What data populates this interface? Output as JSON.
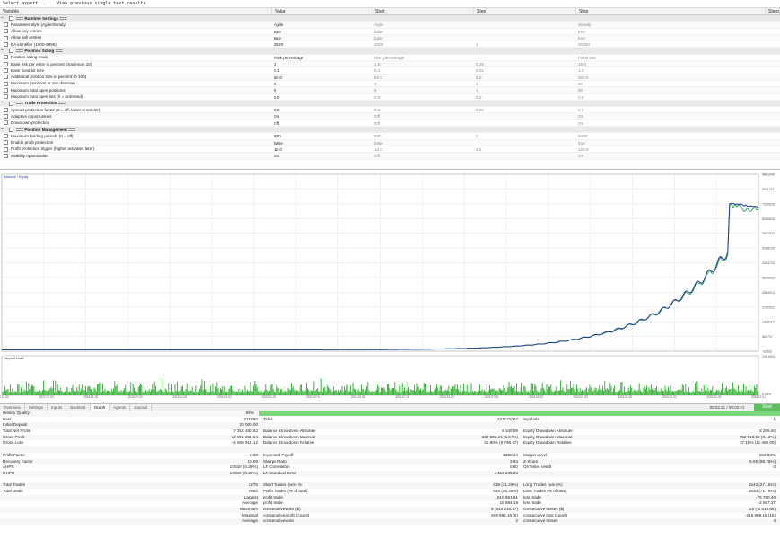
{
  "topbar": {
    "item1": "Select expert...",
    "item2": "View previous single test results"
  },
  "params": {
    "headers": [
      "Variable",
      "Value",
      "Start",
      "Step",
      "Stop",
      "Steps"
    ],
    "rows": [
      {
        "type": "group",
        "name": "=== Runtime Settings ===",
        "value": "",
        "start": "",
        "step": "",
        "stop": ""
      },
      {
        "type": "row",
        "name": "Parameter style (Agile/Steady)",
        "value": "Agile",
        "start": "Agile",
        "step": "",
        "stop": "Steady"
      },
      {
        "type": "row",
        "name": "Allow buy entries",
        "value": "true",
        "start": "false",
        "step": "",
        "stop": "true"
      },
      {
        "type": "row",
        "name": "Allow sell entries",
        "value": "true",
        "start": "false",
        "step": "",
        "stop": "true"
      },
      {
        "type": "row",
        "name": "EA identifier (1000-9999)",
        "value": "2020",
        "start": "2020",
        "step": "1",
        "stop": "20200"
      },
      {
        "type": "group",
        "name": "=== Position Sizing ===",
        "value": "",
        "start": "",
        "step": "",
        "stop": ""
      },
      {
        "type": "row",
        "name": "Position sizing mode",
        "value": "Risk percentage",
        "start": "Risk percentage",
        "step": "",
        "stop": "Fixed lots"
      },
      {
        "type": "row",
        "name": "Base risk per entry in percent (maximum 10)",
        "value": "1",
        "start": "1.5",
        "step": "0.15",
        "stop": "15.0"
      },
      {
        "type": "row",
        "name": "Base fixed lot size",
        "value": "0.1",
        "start": "0.1",
        "step": "0.01",
        "stop": "1.0"
      },
      {
        "type": "row",
        "name": "Additional position size in percent (0-100)",
        "value": "50.0",
        "start": "50.0",
        "step": "5.0",
        "stop": "500.0"
      },
      {
        "type": "row",
        "name": "Maximum positions in one direction",
        "value": "5",
        "start": "5",
        "step": "1",
        "stop": "50"
      },
      {
        "type": "row",
        "name": "Maximum total open positions",
        "value": "5",
        "start": "5",
        "step": "1",
        "stop": "50"
      },
      {
        "type": "row",
        "name": "Maximum total open lots (0 = unlimited)",
        "value": "0.0",
        "start": "0.0",
        "step": "0.0",
        "stop": "0.0"
      },
      {
        "type": "group",
        "name": "=== Trade Protection ===",
        "value": "",
        "start": "",
        "step": "",
        "stop": ""
      },
      {
        "type": "row",
        "name": "Spread protection factor (0 = off, lower is stricter)",
        "value": "0.5",
        "start": "0.5",
        "step": "0.05",
        "stop": "5.0"
      },
      {
        "type": "row",
        "name": "Adaptive opportunities",
        "value": "On",
        "start": "Off",
        "step": "",
        "stop": "On"
      },
      {
        "type": "row",
        "name": "Drawdown protection",
        "value": "Off",
        "start": "Off",
        "step": "",
        "stop": "On"
      },
      {
        "type": "group",
        "name": "=== Position Management ===",
        "value": "",
        "start": "",
        "step": "",
        "stop": ""
      },
      {
        "type": "row",
        "name": "Maximum holding periods (0 = off)",
        "value": "500",
        "start": "500",
        "step": "1",
        "stop": "5000"
      },
      {
        "type": "row",
        "name": "Enable profit protection",
        "value": "false",
        "start": "false",
        "step": "",
        "stop": "true"
      },
      {
        "type": "row",
        "name": "Profit protection trigger (higher activates later)",
        "value": "12.0",
        "start": "12.0",
        "step": "1.2",
        "stop": "120.0"
      },
      {
        "type": "row",
        "name": "Stability optimization",
        "value": "On",
        "start": "Off",
        "step": "",
        "stop": "On"
      }
    ]
  },
  "chart": {
    "legend": "Balance / Equity",
    "deposit_label": "Deposit Load",
    "colors": {
      "balance": "#1f3f8f",
      "equity": "#2a9a5a",
      "load": "#22aa22",
      "grid": "#e6e6e6"
    },
    "y_ticks": [
      "8881646",
      "8011221",
      "7290926",
      "6556925",
      "5822543",
      "5088125",
      "4353724",
      "3619322",
      "2884913",
      "2150511",
      "1416112",
      "681717",
      "-52682"
    ],
    "load_ticks": [
      "100.00%",
      "0.00%"
    ],
    "x_ticks": [
      "2017.01.02",
      "2017.07.03",
      "2018.01.02",
      "2018.07.02",
      "2019.01.02",
      "2019.07.01",
      "2020.01.02",
      "2020.07.01",
      "2021.01.04",
      "2021.07.01",
      "2022.01.03",
      "2022.07.01",
      "2023.01.02",
      "2023.07.03",
      "2024.01.02",
      "2024.07.01",
      "2025.01.02",
      "2025.07.01"
    ]
  },
  "tabs": [
    "Overview",
    "Settings",
    "Inputs",
    "Backtest",
    "Graph",
    "Agents",
    "Journal"
  ],
  "active_tab": "Graph",
  "progress": {
    "time": "00:02:21 / 00:02:21",
    "button": "Start"
  },
  "stats": {
    "history_quality": {
      "label": "History Quality",
      "value": "99%"
    },
    "bars": {
      "label": "Bars",
      "value": "218250",
      "ticks_label": "Ticks",
      "ticks_value": "227121097",
      "symbols_label": "Symbols",
      "symbols_value": "1"
    },
    "initial": {
      "label": "Initial Deposit",
      "value": "20 000.00"
    },
    "rows": [
      [
        "Total Net Profit",
        "7 382 480.62",
        "Balance Drawdown Absolute",
        "5 340.89",
        "Equity Drawdown Absolute",
        "5 286.40"
      ],
      [
        "Gross Profit",
        "12 051 394.64",
        "Balance Drawdown Maximal",
        "432 585.24 (5.57%)",
        "Equity Drawdown Maximal",
        "752 612.52 (9.12%)"
      ],
      [
        "Gross Loss",
        "-4 668 914.12",
        "Balance Drawdown Relative",
        "31.90% (6 798.47)",
        "Equity Drawdown Relative",
        "37.15% (11 496.00)"
      ],
      [
        "",
        "",
        "",
        "",
        "",
        ""
      ],
      [
        "Profit Factor",
        "2.58",
        "Expected Payoff",
        "3228.44",
        "Margin Level",
        "869.83%"
      ],
      [
        "Recovery Factor",
        "10.06",
        "Sharpe Ratio",
        "3.84",
        "Z-Score",
        "-5.65 (99.76%)"
      ],
      [
        "AHPR",
        "1.0029 (0.29%)",
        "LR Correlation",
        "0.80",
        "OnTester result",
        "0"
      ],
      [
        "GHPR",
        "1.0026 (0.26%)",
        "LR Standard Error",
        "1 113 245.83",
        "",
        ""
      ],
      [
        "",
        "",
        "",
        "",
        "",
        ""
      ],
      [
        "Total Trades",
        "2275",
        "Short Trades (won %)",
        "838 (31.29%)",
        "Long Trades (won %)",
        "1543 (27.15%)"
      ],
      [
        "Total Deals",
        "4550",
        "Profit Trades (% of total)",
        "645 (28.35%)",
        "Loss Trades (% of total)",
        "1634 (71.75%)"
      ],
      [
        "",
        "Largest",
        "profit trade",
        "610 851.61",
        "loss trade",
        "-76 780.40"
      ],
      [
        "",
        "Average",
        "profit trade",
        "18 684.19",
        "loss trade",
        "-2 857.37"
      ],
      [
        "",
        "Maximum",
        "consecutive wins ($)",
        "6 (514 216.37)",
        "consecutive losses ($)",
        "20 (-2 618.65)"
      ],
      [
        "",
        "Maximal",
        "consecutive profit (count)",
        "699 962.16 (5)",
        "consecutive loss (count)",
        "-216 989.15 (15)"
      ],
      [
        "",
        "Average",
        "consecutive wins",
        "2",
        "consecutive losses",
        "4"
      ]
    ]
  }
}
